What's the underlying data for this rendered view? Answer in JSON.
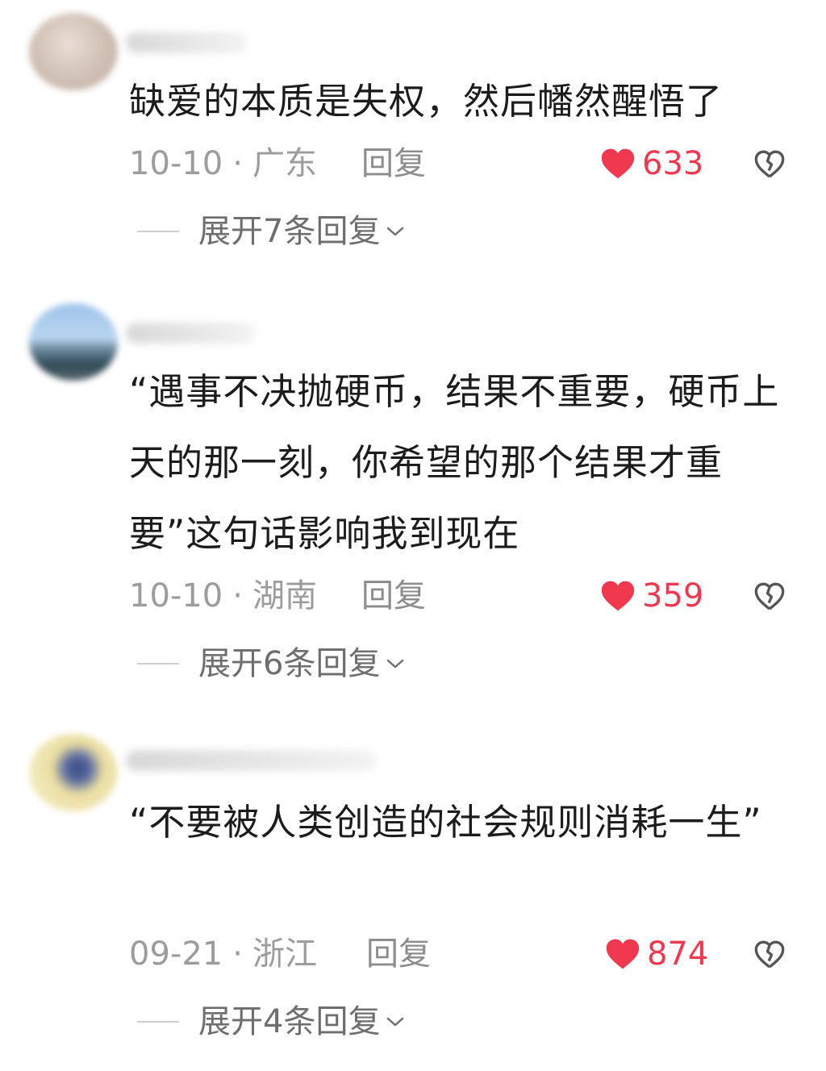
{
  "comments": [
    {
      "text": "缺爱的本质是失权，然后幡然醒悟了",
      "date": "10-10",
      "location": "广东",
      "reply_label": "回复",
      "likes": "633",
      "expand_label": "展开7条回复"
    },
    {
      "text": "“遇事不决抛硬币，结果不重要，硬币上天的那一刻，你希望的那个结果才重要”这句话影响我到现在",
      "date": "10-10",
      "location": "湖南",
      "reply_label": "回复",
      "likes": "359",
      "expand_label": "展开6条回复"
    },
    {
      "text": "“不要被人类创造的社会规则消耗一生”",
      "date": "09-21",
      "location": "浙江",
      "reply_label": "回复",
      "likes": "874",
      "expand_label": "展开4条回复"
    }
  ],
  "separator": "·",
  "colors": {
    "like_red": "#f0384f",
    "meta_gray": "#9c9c9c",
    "text_dark": "#1c1c1c"
  },
  "icons": {
    "like": "heart-icon",
    "dislike": "broken-heart-icon",
    "expand": "chevron-down-icon"
  }
}
